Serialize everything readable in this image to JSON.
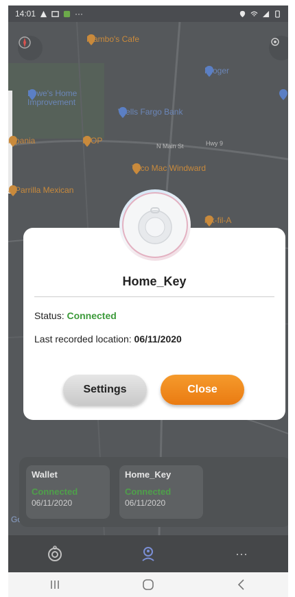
{
  "status_bar": {
    "time": "14:01",
    "left_icons": [
      "alert-icon",
      "image-icon",
      "app-icon",
      "more-dots"
    ],
    "more": "···",
    "right_icons": [
      "location-icon",
      "wifi-icon",
      "signal-icon",
      "battery-icon"
    ]
  },
  "map": {
    "places": [
      {
        "name": "Mambo's Cafe",
        "type": "food"
      },
      {
        "name": "Kroger",
        "type": "shop"
      },
      {
        "name": "Lowe's Home\nImprovement",
        "type": "shop"
      },
      {
        "name": "Wells Fargo Bank",
        "type": "bank"
      },
      {
        "name": "mpania",
        "type": "food"
      },
      {
        "name": "IHOP",
        "type": "food"
      },
      {
        "name": "Taco Mac Windward",
        "type": "food"
      },
      {
        "name": "a Parrilla Mexican",
        "type": "food"
      },
      {
        "name": "ick-fil-A",
        "type": "food"
      }
    ],
    "streets": [
      "N Main St",
      "Hwy 9"
    ]
  },
  "dialog": {
    "device_name": "Home_Key",
    "status_label": "Status: ",
    "status_value": "Connected",
    "location_label": "Last recorded location: ",
    "location_value": "06/11/2020",
    "settings_label": "Settings",
    "close_label": "Close"
  },
  "devices": [
    {
      "name": "Wallet",
      "status": "Connected",
      "date": "06/11/2020"
    },
    {
      "name": "Home_Key",
      "status": "Connected",
      "date": "06/11/2020"
    }
  ],
  "map_attribution": "Go",
  "tabbar": {
    "items": [
      "devices-tab",
      "location-tab",
      "more-tab"
    ],
    "more": "···"
  },
  "colors": {
    "accent_orange": "#ea7b12",
    "connected_green": "#3c9a3a"
  }
}
